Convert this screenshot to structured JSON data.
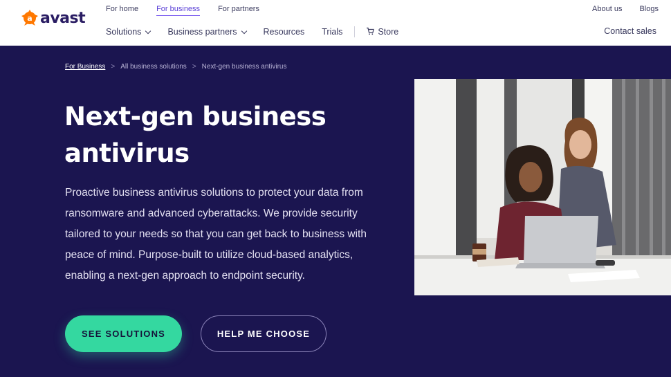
{
  "brand": {
    "name": "avast",
    "accent": "#ff7800"
  },
  "top_links": [
    {
      "label": "For home"
    },
    {
      "label": "For business"
    },
    {
      "label": "For partners"
    }
  ],
  "top_right": [
    {
      "label": "About us"
    },
    {
      "label": "Blogs"
    }
  ],
  "main_nav": {
    "solutions": "Solutions",
    "business_partners": "Business partners",
    "resources": "Resources",
    "trials": "Trials",
    "store": "Store",
    "contact_sales": "Contact sales"
  },
  "breadcrumb": [
    {
      "label": "For Business"
    },
    {
      "label": "All business solutions"
    },
    {
      "label": "Next-gen business antivirus"
    }
  ],
  "breadcrumb_separator": ">",
  "hero": {
    "title": "Next-gen business antivirus",
    "description": "Proactive business antivirus solutions to protect your data from ransomware and advanced cyberattacks. We provide security tailored to your needs so that you can get back to business with peace of mind. Purpose-built to utilize cloud-based analytics, enabling a next-gen approach to endpoint security.",
    "primary_button": "SEE SOLUTIONS",
    "secondary_button": "HELP ME CHOOSE",
    "background": "#1b1550",
    "primary_color": "#34d8a0"
  },
  "icons": {
    "logo": "avast-logo-icon",
    "cart": "cart-icon",
    "chevron": "chevron-down-icon"
  }
}
